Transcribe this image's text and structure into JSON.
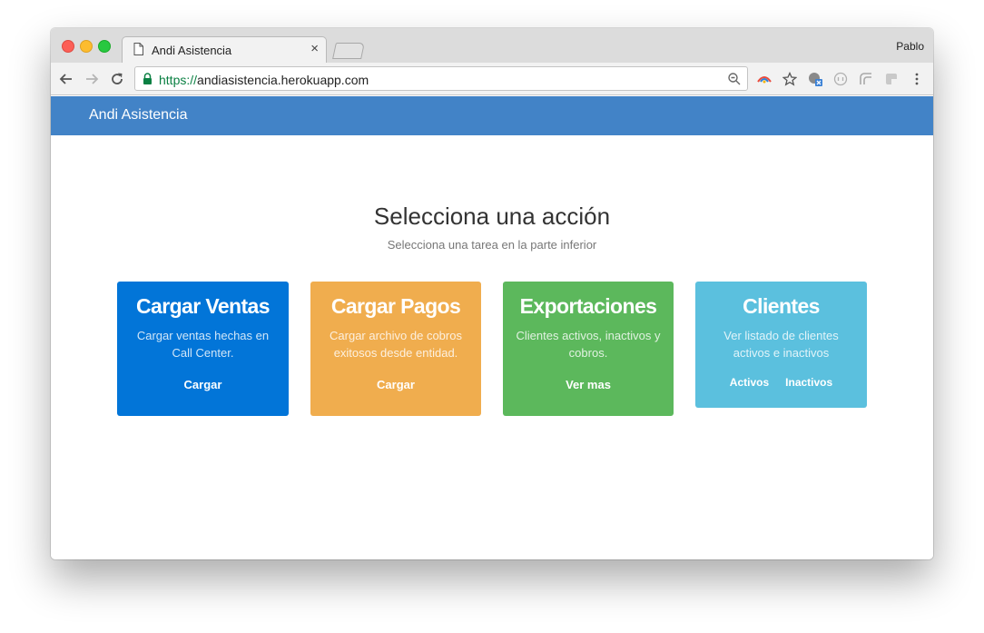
{
  "browser": {
    "tab_title": "Andi Asistencia",
    "close_glyph": "×",
    "profile_name": "Pablo",
    "url_scheme": "https://",
    "url_host": "andiasistencia.herokuapp.com",
    "icons": [
      "page-icon",
      "close-icon",
      "back-arrow-icon",
      "forward-arrow-icon",
      "reload-icon",
      "lock-icon",
      "zoom-icon",
      "extension-icon",
      "star-icon",
      "menu-icon"
    ]
  },
  "navbar": {
    "brand": "Andi Asistencia",
    "color": "#4283c7"
  },
  "main": {
    "title": "Selecciona una acción",
    "subtitle": "Selecciona una tarea en la parte inferior",
    "cards": [
      {
        "title": "Cargar Ventas",
        "description": "Cargar ventas hechas en Call Center.",
        "link": "Cargar",
        "color": "#0275d8"
      },
      {
        "title": "Cargar Pagos",
        "description": "Cargar archivo de cobros exitosos desde entidad.",
        "link": "Cargar",
        "color": "#f0ad4e"
      },
      {
        "title": "Exportaciones",
        "description": "Clientes activos, inactivos y cobros.",
        "link": "Ver mas",
        "color": "#5cb85c"
      },
      {
        "title": "Clientes",
        "description": "Ver listado de clientes activos e inactivos",
        "links": [
          "Activos",
          "Inactivos"
        ],
        "color": "#5bc0de"
      }
    ]
  }
}
